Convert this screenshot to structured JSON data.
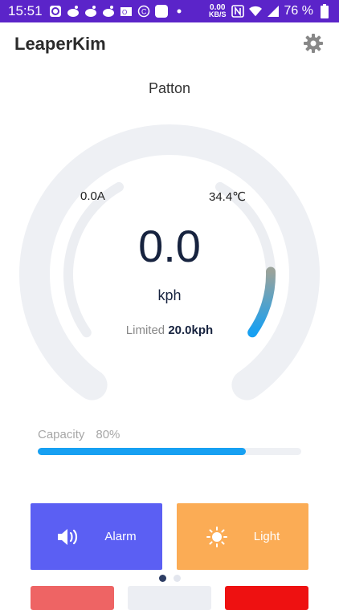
{
  "status_bar": {
    "time": "15:51",
    "net_speed_value": "0.00",
    "net_speed_unit": "KB/S",
    "battery": "76 %"
  },
  "app": {
    "title": "LeaperKim",
    "settings_icon": "gear-icon"
  },
  "device": {
    "name": "Patton"
  },
  "gauge": {
    "current": "0.0A",
    "temperature": "34.4℃",
    "speed": "0.0",
    "unit": "kph",
    "limited_label": "Limited",
    "limited_value": "20.0kph",
    "speed_fraction": 0.0,
    "indicator_fraction": 0.22,
    "colors": {
      "track": "#eef0f4",
      "inner_track": "#eceef2",
      "indicator_start": "#17a0f2",
      "indicator_end": "#9aa39b"
    }
  },
  "capacity": {
    "label": "Capacity",
    "value": "80%",
    "fraction": 0.8,
    "color": "#17a0f2"
  },
  "actions": {
    "alarm_label": "Alarm",
    "alarm_icon": "speaker-icon",
    "light_label": "Light",
    "light_icon": "sun-icon"
  },
  "pager": {
    "pages": 2,
    "active": 0
  }
}
